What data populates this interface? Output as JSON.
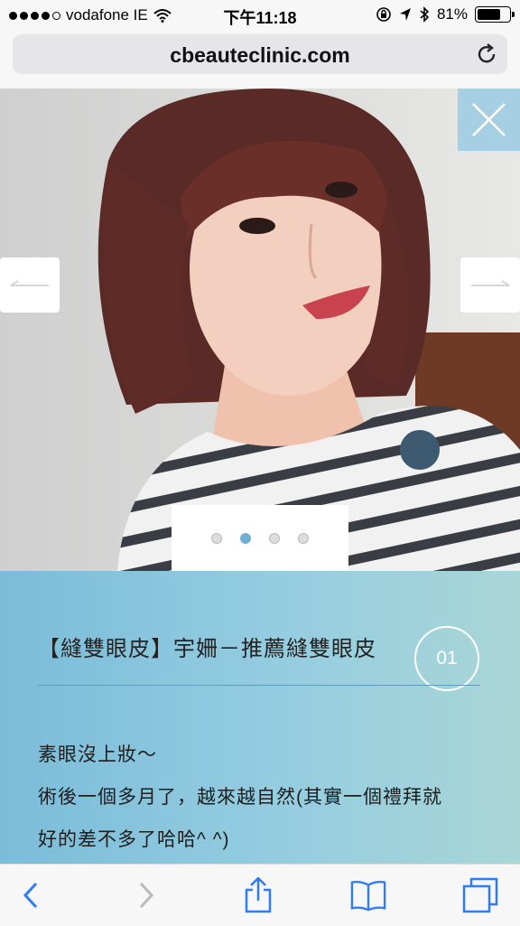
{
  "status_bar": {
    "carrier": "vodafone IE",
    "time": "下午11:18",
    "battery_percent": "81%",
    "battery_level": 0.81
  },
  "browser": {
    "url": "cbeauteclinic.com"
  },
  "slider": {
    "total_slides": 4,
    "active_slide": 2
  },
  "article": {
    "title": "【縫雙眼皮】宇姍－推薦縫雙眼皮",
    "number": "01",
    "lines": [
      "素眼沒上妝～",
      "術後一個多月了，越來越自然(其實一個禮拜就",
      "好的差不多了哈哈^ ^)"
    ]
  },
  "colors": {
    "accent": "#a7cfe3",
    "pager_active": "#6fb0d6",
    "ios_blue": "#2f7cf6"
  }
}
